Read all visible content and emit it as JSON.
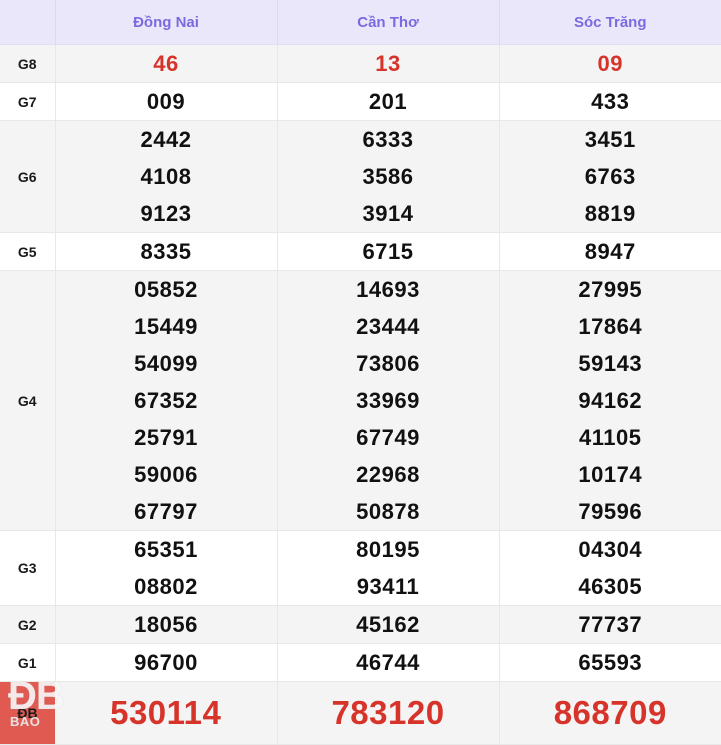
{
  "table": {
    "corner_label": "",
    "columns": [
      "Đồng Nai",
      "Cần Thơ",
      "Sóc Trăng"
    ],
    "rows": [
      {
        "prize": "G8",
        "style": "red",
        "values": [
          [
            "46"
          ],
          [
            "13"
          ],
          [
            "09"
          ]
        ]
      },
      {
        "prize": "G7",
        "style": "normal",
        "values": [
          [
            "009"
          ],
          [
            "201"
          ],
          [
            "433"
          ]
        ]
      },
      {
        "prize": "G6",
        "style": "normal",
        "values": [
          [
            "2442",
            "4108",
            "9123"
          ],
          [
            "6333",
            "3586",
            "3914"
          ],
          [
            "3451",
            "6763",
            "8819"
          ]
        ]
      },
      {
        "prize": "G5",
        "style": "normal",
        "values": [
          [
            "8335"
          ],
          [
            "6715"
          ],
          [
            "8947"
          ]
        ]
      },
      {
        "prize": "G4",
        "style": "normal",
        "values": [
          [
            "05852",
            "15449",
            "54099",
            "67352",
            "25791",
            "59006",
            "67797"
          ],
          [
            "14693",
            "23444",
            "73806",
            "33969",
            "67749",
            "22968",
            "50878"
          ],
          [
            "27995",
            "17864",
            "59143",
            "94162",
            "41105",
            "10174",
            "79596"
          ]
        ]
      },
      {
        "prize": "G3",
        "style": "normal",
        "values": [
          [
            "65351",
            "08802"
          ],
          [
            "80195",
            "93411"
          ],
          [
            "04304",
            "46305"
          ]
        ]
      },
      {
        "prize": "G2",
        "style": "normal",
        "values": [
          [
            "18056"
          ],
          [
            "45162"
          ],
          [
            "77737"
          ]
        ]
      },
      {
        "prize": "G1",
        "style": "normal",
        "values": [
          [
            "96700"
          ],
          [
            "46744"
          ],
          [
            "65593"
          ]
        ]
      },
      {
        "prize": "ĐB",
        "style": "special",
        "values": [
          [
            "530114"
          ],
          [
            "783120"
          ],
          [
            "868709"
          ]
        ]
      }
    ]
  },
  "watermark": {
    "line1": "ĐB",
    "line2": "BAO"
  },
  "colors": {
    "header_background": "#ebe7fb",
    "header_text": "#7a6ae0",
    "prize_red": "#d6342a",
    "special_label_background": "#e05a52",
    "row_stripe": "#f4f4f4",
    "row_plain": "#ffffff",
    "number_text": "#111111"
  }
}
